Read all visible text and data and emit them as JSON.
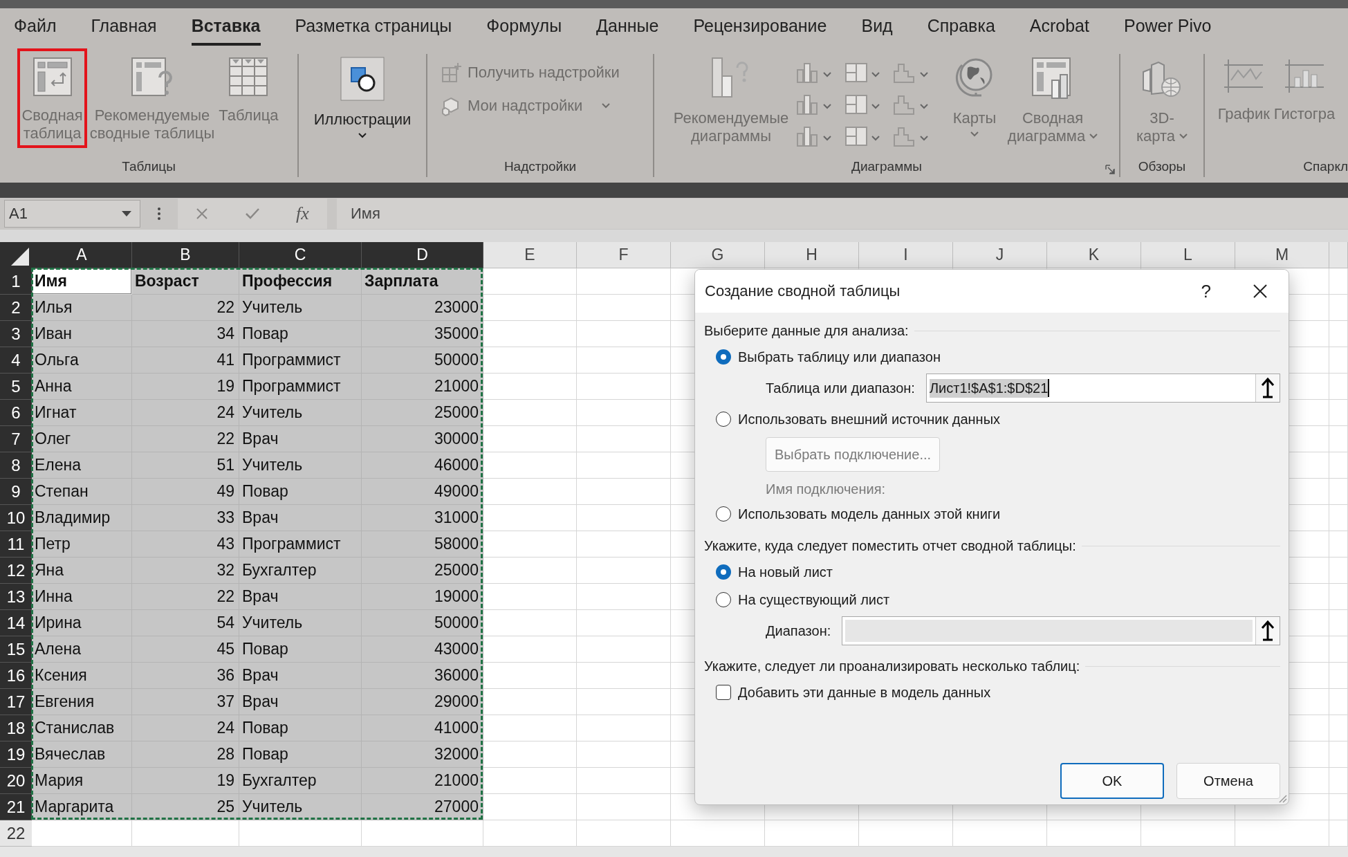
{
  "tabs": [
    {
      "label": "Файл",
      "selected": false
    },
    {
      "label": "Главная",
      "selected": false
    },
    {
      "label": "Вставка",
      "selected": true
    },
    {
      "label": "Разметка страницы",
      "selected": false
    },
    {
      "label": "Формулы",
      "selected": false
    },
    {
      "label": "Данные",
      "selected": false
    },
    {
      "label": "Рецензирование",
      "selected": false
    },
    {
      "label": "Вид",
      "selected": false
    },
    {
      "label": "Справка",
      "selected": false
    },
    {
      "label": "Acrobat",
      "selected": false
    },
    {
      "label": "Power Pivo",
      "selected": false
    }
  ],
  "ribbon": {
    "groups": [
      {
        "label": "Таблицы",
        "buttons": [
          {
            "label": "Сводная\nтаблица",
            "highlighted": true,
            "disabled": true
          },
          {
            "label": "Рекомендуемые\nсводные таблицы",
            "highlighted": false,
            "disabled": true
          },
          {
            "label": "Таблица",
            "highlighted": false,
            "disabled": true
          }
        ]
      },
      {
        "buttons": [
          {
            "label": "Иллюстрации",
            "dropdown": true,
            "disabled": false
          }
        ]
      },
      {
        "label": "Надстройки",
        "buttons": [
          {
            "label": "Получить надстройки",
            "dropdown": false,
            "disabled": true
          },
          {
            "label": "Мои надстройки",
            "dropdown": true,
            "disabled": true
          }
        ]
      },
      {
        "label": "Диаграммы",
        "launcher": true,
        "buttons": [
          {
            "label": "Рекомендуемые\nдиаграммы",
            "disabled": true
          },
          {
            "label": "Карты",
            "dropdown": true,
            "disabled": true
          },
          {
            "label": "Сводная\nдиаграмма",
            "dropdown": true,
            "disabled": true
          }
        ]
      },
      {
        "label": "Обзоры",
        "buttons": [
          {
            "label": "3D-\nкарта",
            "dropdown": true,
            "disabled": true
          }
        ]
      },
      {
        "label": "Спаркл",
        "buttons": [
          {
            "label": "График",
            "disabled": true
          },
          {
            "label": "Гистогра",
            "disabled": true
          }
        ]
      }
    ]
  },
  "formula_bar": {
    "name_box": "A1",
    "function_label": "fx",
    "value": "Имя"
  },
  "sheet": {
    "columns": [
      {
        "letter": "A",
        "kind": "text",
        "selected": true
      },
      {
        "letter": "B",
        "kind": "number",
        "selected": true
      },
      {
        "letter": "C",
        "kind": "text",
        "selected": true
      },
      {
        "letter": "D",
        "kind": "number",
        "selected": true
      },
      {
        "letter": "E",
        "kind": "text",
        "selected": false
      },
      {
        "letter": "F",
        "kind": "text",
        "selected": false
      },
      {
        "letter": "G",
        "kind": "text",
        "selected": false
      },
      {
        "letter": "H",
        "kind": "text",
        "selected": false
      },
      {
        "letter": "I",
        "kind": "text",
        "selected": false
      },
      {
        "letter": "J",
        "kind": "text",
        "selected": false
      },
      {
        "letter": "K",
        "kind": "text",
        "selected": false
      },
      {
        "letter": "L",
        "kind": "text",
        "selected": false
      },
      {
        "letter": "M",
        "kind": "text",
        "selected": false
      }
    ],
    "rows": [
      {
        "number": "1",
        "kind": "header",
        "selected": true,
        "active": true,
        "cells": [
          "Имя",
          "Возраст",
          "Профессия",
          "Зарплата"
        ]
      },
      {
        "number": "2",
        "kind": "data",
        "selected": true,
        "active": false,
        "cells": [
          "Илья",
          "22",
          "Учитель",
          "23000"
        ]
      },
      {
        "number": "3",
        "kind": "data",
        "selected": true,
        "active": false,
        "cells": [
          "Иван",
          "34",
          "Повар",
          "35000"
        ]
      },
      {
        "number": "4",
        "kind": "data",
        "selected": true,
        "active": false,
        "cells": [
          "Ольга",
          "41",
          "Программист",
          "50000"
        ]
      },
      {
        "number": "5",
        "kind": "data",
        "selected": true,
        "active": false,
        "cells": [
          "Анна",
          "19",
          "Программист",
          "21000"
        ]
      },
      {
        "number": "6",
        "kind": "data",
        "selected": true,
        "active": false,
        "cells": [
          "Игнат",
          "24",
          "Учитель",
          "25000"
        ]
      },
      {
        "number": "7",
        "kind": "data",
        "selected": true,
        "active": false,
        "cells": [
          "Олег",
          "22",
          "Врач",
          "30000"
        ]
      },
      {
        "number": "8",
        "kind": "data",
        "selected": true,
        "active": false,
        "cells": [
          "Елена",
          "51",
          "Учитель",
          "46000"
        ]
      },
      {
        "number": "9",
        "kind": "data",
        "selected": true,
        "active": false,
        "cells": [
          "Степан",
          "49",
          "Повар",
          "49000"
        ]
      },
      {
        "number": "10",
        "kind": "data",
        "selected": true,
        "active": false,
        "cells": [
          "Владимир",
          "33",
          "Врач",
          "31000"
        ]
      },
      {
        "number": "11",
        "kind": "data",
        "selected": true,
        "active": false,
        "cells": [
          "Петр",
          "43",
          "Программист",
          "58000"
        ]
      },
      {
        "number": "12",
        "kind": "data",
        "selected": true,
        "active": false,
        "cells": [
          "Яна",
          "32",
          "Бухгалтер",
          "25000"
        ]
      },
      {
        "number": "13",
        "kind": "data",
        "selected": true,
        "active": false,
        "cells": [
          "Инна",
          "22",
          "Врач",
          "19000"
        ]
      },
      {
        "number": "14",
        "kind": "data",
        "selected": true,
        "active": false,
        "cells": [
          "Ирина",
          "54",
          "Учитель",
          "50000"
        ]
      },
      {
        "number": "15",
        "kind": "data",
        "selected": true,
        "active": false,
        "cells": [
          "Алена",
          "45",
          "Повар",
          "43000"
        ]
      },
      {
        "number": "16",
        "kind": "data",
        "selected": true,
        "active": false,
        "cells": [
          "Ксения",
          "36",
          "Врач",
          "36000"
        ]
      },
      {
        "number": "17",
        "kind": "data",
        "selected": true,
        "active": false,
        "cells": [
          "Евгения",
          "37",
          "Врач",
          "29000"
        ]
      },
      {
        "number": "18",
        "kind": "data",
        "selected": true,
        "active": false,
        "cells": [
          "Станислав",
          "24",
          "Повар",
          "41000"
        ]
      },
      {
        "number": "19",
        "kind": "data",
        "selected": true,
        "active": false,
        "cells": [
          "Вячеслав",
          "28",
          "Повар",
          "32000"
        ]
      },
      {
        "number": "20",
        "kind": "data",
        "selected": true,
        "active": false,
        "cells": [
          "Мария",
          "19",
          "Бухгалтер",
          "21000"
        ]
      },
      {
        "number": "21",
        "kind": "data",
        "selected": true,
        "active": false,
        "cells": [
          "Маргарита",
          "25",
          "Учитель",
          "27000"
        ]
      },
      {
        "number": "22",
        "kind": "data",
        "selected": false,
        "active": false,
        "cells": []
      }
    ]
  },
  "dialog": {
    "title": "Создание сводной таблицы",
    "help": "?",
    "sections": [
      {
        "heading": "Выберите данные для анализа:",
        "items": [
          {
            "kind": "radio",
            "label": "Выбрать таблицу или диапазон",
            "selected": true
          },
          {
            "kind": "field",
            "label": "Таблица или диапазон:",
            "value": "Лист1!$A$1:$D$21",
            "disabled": false
          },
          {
            "kind": "radio",
            "label": "Использовать внешний источник данных",
            "selected": false
          },
          {
            "kind": "button",
            "label": "Выбрать подключение...",
            "disabled": true
          },
          {
            "kind": "note",
            "label": "Имя подключения:"
          },
          {
            "kind": "radio",
            "label": "Использовать модель данных этой книги",
            "selected": false
          }
        ]
      },
      {
        "heading": "Укажите, куда следует поместить отчет сводной таблицы:",
        "items": [
          {
            "kind": "radio",
            "label": "На новый лист",
            "selected": true
          },
          {
            "kind": "radio",
            "label": "На существующий лист",
            "selected": false
          },
          {
            "kind": "field",
            "label": "Диапазон:",
            "disabled": true
          }
        ]
      },
      {
        "heading": "Укажите, следует ли проанализировать несколько таблиц:",
        "items": [
          {
            "kind": "checkbox",
            "label": "Добавить эти данные в модель данных",
            "checked": false
          }
        ]
      }
    ],
    "buttons": [
      {
        "label": "OK",
        "default": true
      },
      {
        "label": "Отмена",
        "default": false
      }
    ]
  }
}
